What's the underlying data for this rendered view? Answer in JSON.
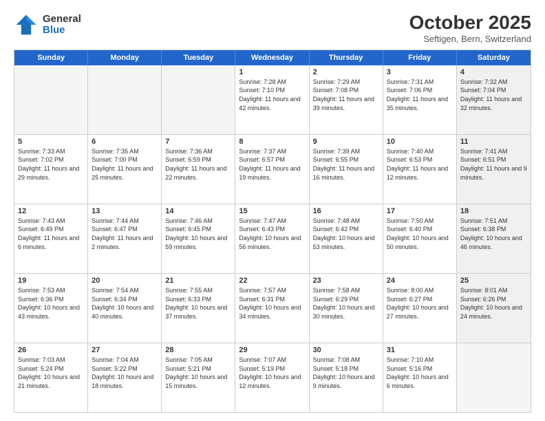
{
  "header": {
    "logo_general": "General",
    "logo_blue": "Blue",
    "month_title": "October 2025",
    "location": "Seftigen, Bern, Switzerland"
  },
  "weekdays": [
    "Sunday",
    "Monday",
    "Tuesday",
    "Wednesday",
    "Thursday",
    "Friday",
    "Saturday"
  ],
  "rows": [
    [
      {
        "day": "",
        "text": "",
        "empty": true
      },
      {
        "day": "",
        "text": "",
        "empty": true
      },
      {
        "day": "",
        "text": "",
        "empty": true
      },
      {
        "day": "1",
        "text": "Sunrise: 7:28 AM\nSunset: 7:10 PM\nDaylight: 11 hours and 42 minutes."
      },
      {
        "day": "2",
        "text": "Sunrise: 7:29 AM\nSunset: 7:08 PM\nDaylight: 11 hours and 39 minutes."
      },
      {
        "day": "3",
        "text": "Sunrise: 7:31 AM\nSunset: 7:06 PM\nDaylight: 11 hours and 35 minutes."
      },
      {
        "day": "4",
        "text": "Sunrise: 7:32 AM\nSunset: 7:04 PM\nDaylight: 11 hours and 32 minutes.",
        "shaded": true
      }
    ],
    [
      {
        "day": "5",
        "text": "Sunrise: 7:33 AM\nSunset: 7:02 PM\nDaylight: 11 hours and 29 minutes."
      },
      {
        "day": "6",
        "text": "Sunrise: 7:35 AM\nSunset: 7:00 PM\nDaylight: 11 hours and 25 minutes."
      },
      {
        "day": "7",
        "text": "Sunrise: 7:36 AM\nSunset: 6:59 PM\nDaylight: 11 hours and 22 minutes."
      },
      {
        "day": "8",
        "text": "Sunrise: 7:37 AM\nSunset: 6:57 PM\nDaylight: 11 hours and 19 minutes."
      },
      {
        "day": "9",
        "text": "Sunrise: 7:39 AM\nSunset: 6:55 PM\nDaylight: 11 hours and 16 minutes."
      },
      {
        "day": "10",
        "text": "Sunrise: 7:40 AM\nSunset: 6:53 PM\nDaylight: 11 hours and 12 minutes."
      },
      {
        "day": "11",
        "text": "Sunrise: 7:41 AM\nSunset: 6:51 PM\nDaylight: 11 hours and 9 minutes.",
        "shaded": true
      }
    ],
    [
      {
        "day": "12",
        "text": "Sunrise: 7:43 AM\nSunset: 6:49 PM\nDaylight: 11 hours and 6 minutes."
      },
      {
        "day": "13",
        "text": "Sunrise: 7:44 AM\nSunset: 6:47 PM\nDaylight: 11 hours and 2 minutes."
      },
      {
        "day": "14",
        "text": "Sunrise: 7:46 AM\nSunset: 6:45 PM\nDaylight: 10 hours and 59 minutes."
      },
      {
        "day": "15",
        "text": "Sunrise: 7:47 AM\nSunset: 6:43 PM\nDaylight: 10 hours and 56 minutes."
      },
      {
        "day": "16",
        "text": "Sunrise: 7:48 AM\nSunset: 6:42 PM\nDaylight: 10 hours and 53 minutes."
      },
      {
        "day": "17",
        "text": "Sunrise: 7:50 AM\nSunset: 6:40 PM\nDaylight: 10 hours and 50 minutes."
      },
      {
        "day": "18",
        "text": "Sunrise: 7:51 AM\nSunset: 6:38 PM\nDaylight: 10 hours and 46 minutes.",
        "shaded": true
      }
    ],
    [
      {
        "day": "19",
        "text": "Sunrise: 7:53 AM\nSunset: 6:36 PM\nDaylight: 10 hours and 43 minutes."
      },
      {
        "day": "20",
        "text": "Sunrise: 7:54 AM\nSunset: 6:34 PM\nDaylight: 10 hours and 40 minutes."
      },
      {
        "day": "21",
        "text": "Sunrise: 7:55 AM\nSunset: 6:33 PM\nDaylight: 10 hours and 37 minutes."
      },
      {
        "day": "22",
        "text": "Sunrise: 7:57 AM\nSunset: 6:31 PM\nDaylight: 10 hours and 34 minutes."
      },
      {
        "day": "23",
        "text": "Sunrise: 7:58 AM\nSunset: 6:29 PM\nDaylight: 10 hours and 30 minutes."
      },
      {
        "day": "24",
        "text": "Sunrise: 8:00 AM\nSunset: 6:27 PM\nDaylight: 10 hours and 27 minutes."
      },
      {
        "day": "25",
        "text": "Sunrise: 8:01 AM\nSunset: 6:26 PM\nDaylight: 10 hours and 24 minutes.",
        "shaded": true
      }
    ],
    [
      {
        "day": "26",
        "text": "Sunrise: 7:03 AM\nSunset: 5:24 PM\nDaylight: 10 hours and 21 minutes."
      },
      {
        "day": "27",
        "text": "Sunrise: 7:04 AM\nSunset: 5:22 PM\nDaylight: 10 hours and 18 minutes."
      },
      {
        "day": "28",
        "text": "Sunrise: 7:05 AM\nSunset: 5:21 PM\nDaylight: 10 hours and 15 minutes."
      },
      {
        "day": "29",
        "text": "Sunrise: 7:07 AM\nSunset: 5:19 PM\nDaylight: 10 hours and 12 minutes."
      },
      {
        "day": "30",
        "text": "Sunrise: 7:08 AM\nSunset: 5:18 PM\nDaylight: 10 hours and 9 minutes."
      },
      {
        "day": "31",
        "text": "Sunrise: 7:10 AM\nSunset: 5:16 PM\nDaylight: 10 hours and 6 minutes."
      },
      {
        "day": "",
        "text": "",
        "empty": true,
        "shaded": true
      }
    ]
  ]
}
